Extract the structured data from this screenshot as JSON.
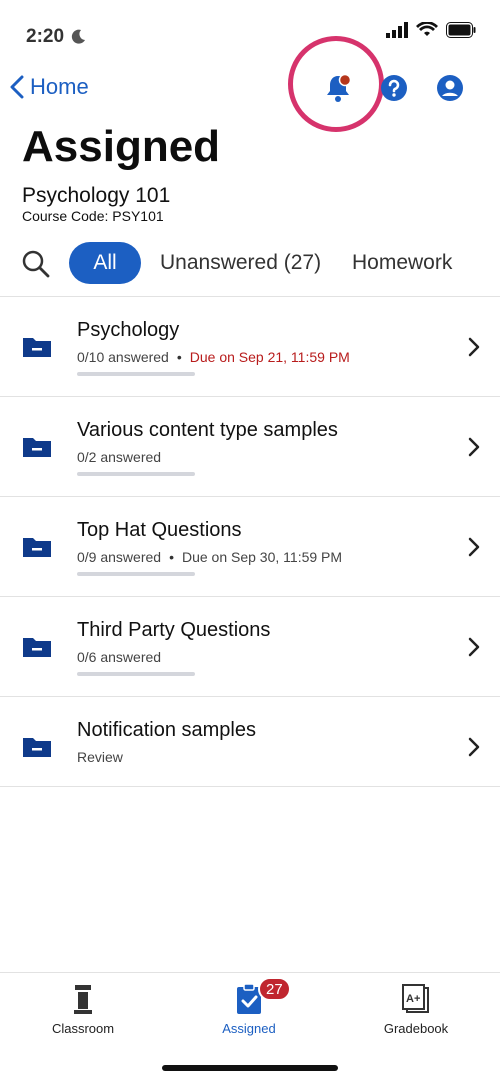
{
  "status": {
    "time": "2:20"
  },
  "nav": {
    "back_label": "Home"
  },
  "header": {
    "title": "Assigned",
    "course_name": "Psychology 101",
    "course_code": "Course Code: PSY101"
  },
  "filters": {
    "all": "All",
    "unanswered": "Unanswered (27)",
    "homework": "Homework"
  },
  "items": [
    {
      "title": "Psychology",
      "answered": "0/10 answered",
      "due": "Due on Sep 21, 11:59 PM",
      "due_color": "#b81c1c"
    },
    {
      "title": "Various content type samples",
      "answered": "0/2 answered"
    },
    {
      "title": "Top Hat Questions",
      "answered": "0/9 answered",
      "due": "Due on Sep 30, 11:59 PM"
    },
    {
      "title": "Third Party Questions",
      "answered": "0/6 answered"
    },
    {
      "title": "Notification samples",
      "answered": "Review"
    }
  ],
  "tabs": {
    "classroom": "Classroom",
    "assigned": "Assigned",
    "assigned_badge": "27",
    "gradebook": "Gradebook"
  },
  "colors": {
    "accent": "#1c5fc2",
    "highlight": "#d6336c",
    "badge": "#c0262f",
    "folder": "#0f3a8a"
  }
}
